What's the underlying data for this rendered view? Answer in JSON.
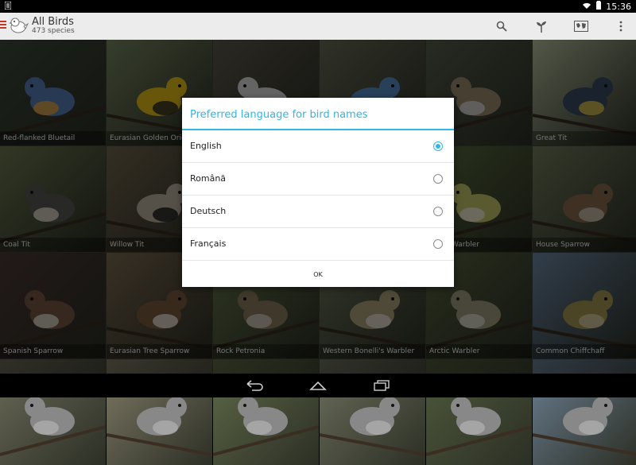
{
  "status_bar": {
    "time": "15:36"
  },
  "app": {
    "title": "All Birds",
    "subtitle": "473 species"
  },
  "action_icons": [
    "search-icon",
    "sprout-icon",
    "map-icon",
    "overflow-icon"
  ],
  "tiles": [
    {
      "name": "Red-flanked Bluetail",
      "bg": "#3f4a3d",
      "bird": "#5a7fb8",
      "accent": "#e8a640"
    },
    {
      "name": "Eurasian Golden Oriole",
      "bg": "#7b8a64",
      "bird": "#e6c21a",
      "accent": "#2a2a2a"
    },
    {
      "name": "",
      "bg": "#5e5a4e",
      "bird": "#dedede",
      "accent": "#222"
    },
    {
      "name": "",
      "bg": "#6a6e59",
      "bird": "#5b8fc7",
      "accent": "#e8d34a"
    },
    {
      "name": "",
      "bg": "#58604d",
      "bird": "#a08c72",
      "accent": "#ddd"
    },
    {
      "name": "Great Tit",
      "bg": "#b7c2a0",
      "bird": "#3b4c67",
      "accent": "#e3c84a"
    },
    {
      "name": "Coal Tit",
      "bg": "#6f7b52",
      "bird": "#5a5a55",
      "accent": "#e8e2d0"
    },
    {
      "name": "Willow Tit",
      "bg": "#73684f",
      "bird": "#bdb3a0",
      "accent": "#1f1f1f"
    },
    {
      "name": "",
      "bg": "#5f6b4b",
      "bird": "#7a7a62",
      "accent": "#ccc"
    },
    {
      "name": "",
      "bg": "#57643f",
      "bird": "#9c8c5c",
      "accent": "#ccc"
    },
    {
      "name": "Wood Warbler",
      "bg": "#5c7040",
      "bird": "#c7c76a",
      "accent": "#f2efdc"
    },
    {
      "name": "House Sparrow",
      "bg": "#75805f",
      "bird": "#8a6e4e",
      "accent": "#d0c8b5"
    },
    {
      "name": "Spanish Sparrow",
      "bg": "#4c3a36",
      "bird": "#7a5a46",
      "accent": "#e3ddd2"
    },
    {
      "name": "Eurasian Tree Sparrow",
      "bg": "#7d6b52",
      "bird": "#7b5c3e",
      "accent": "#ece6dc"
    },
    {
      "name": "Rock Petronia",
      "bg": "#6a7a4f",
      "bird": "#8c7c60",
      "accent": "#d8cfbf"
    },
    {
      "name": "Western Bonelli's Warbler",
      "bg": "#707a5d",
      "bird": "#b0a27c",
      "accent": "#e8e4da"
    },
    {
      "name": "Arctic Warbler",
      "bg": "#5b6843",
      "bird": "#a19e80",
      "accent": "#e2dfcf"
    },
    {
      "name": "Common Chiffchaff",
      "bg": "#6e8aa6",
      "bird": "#a89a52",
      "accent": "#d9d1a8"
    },
    {
      "name": "",
      "bg": "#6a6a58",
      "bird": "#888",
      "accent": "#aaa"
    },
    {
      "name": "",
      "bg": "#7f7a66",
      "bird": "#888",
      "accent": "#aaa"
    },
    {
      "name": "",
      "bg": "#5f6a48",
      "bird": "#888",
      "accent": "#aaa"
    },
    {
      "name": "",
      "bg": "#6c6f5c",
      "bird": "#888",
      "accent": "#aaa"
    },
    {
      "name": "",
      "bg": "#4f5a3c",
      "bird": "#888",
      "accent": "#aaa"
    },
    {
      "name": "",
      "bg": "#6b7f92",
      "bird": "#888",
      "accent": "#aaa"
    }
  ],
  "dialog": {
    "title": "Preferred language for bird names",
    "options": [
      {
        "label": "English",
        "selected": true
      },
      {
        "label": "Română",
        "selected": false
      },
      {
        "label": "Deutsch",
        "selected": false
      },
      {
        "label": "Français",
        "selected": false
      }
    ],
    "ok_label": "OK"
  },
  "colors": {
    "accent": "#33b5e5",
    "menu": "#c0392b"
  }
}
